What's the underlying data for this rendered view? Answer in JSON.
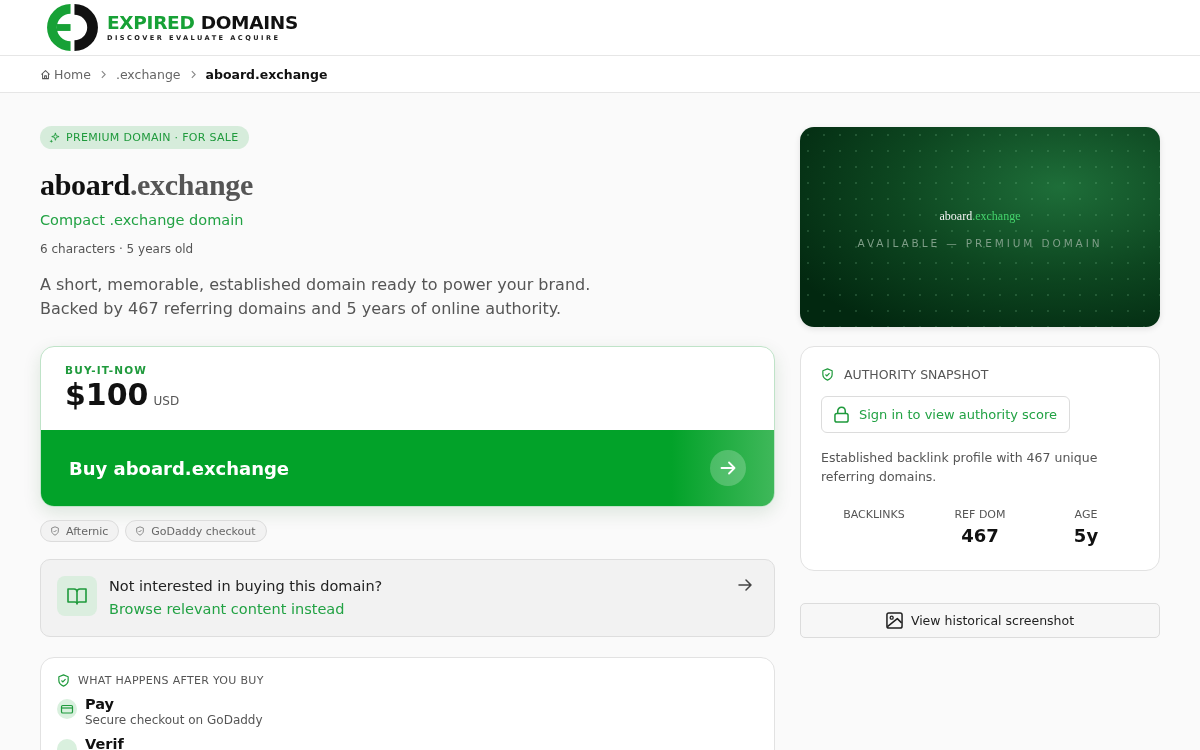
{
  "header": {
    "logo": {
      "word_1": "EXPIRED",
      "word_2": "DOMAINS",
      "tagline": "DISCOVER EVALUATE ACQUIRE"
    }
  },
  "breadcrumb": [
    {
      "label": "Home",
      "current": false
    },
    {
      "label": ".exchange",
      "current": false
    },
    {
      "label": "aboard.exchange",
      "current": true
    }
  ],
  "listing": {
    "badge": "PREMIUM DOMAIN · FOR SALE",
    "domain": {
      "name": "aboard",
      "tld": ".exchange"
    },
    "subtitle": "Compact .exchange domain",
    "meta": "6 characters · 5 years old",
    "description": "A short, memorable, established domain ready to power your brand. Backed by 467 referring domains and 5 years of online authority."
  },
  "purchase": {
    "label": "BUY-IT-NOW",
    "price": "$100",
    "currency": "USD",
    "button": "Buy aboard.exchange",
    "chips": [
      "Afternic",
      "GoDaddy checkout"
    ]
  },
  "alternative": {
    "question": "Not interested in buying this domain?",
    "link": "Browse relevant content instead"
  },
  "after_buy": {
    "title": "WHAT HAPPENS AFTER YOU BUY",
    "steps": [
      {
        "kind": "pay",
        "title": "Pay",
        "text": "Secure checkout on GoDaddy"
      },
      {
        "kind": "plain",
        "title": "Verif"
      }
    ]
  },
  "preview": {
    "name": "aboard",
    "tld": ".exchange",
    "caption": "AVAILABLE — PREMIUM DOMAIN"
  },
  "authority": {
    "title": "AUTHORITY SNAPSHOT",
    "sign_in": "Sign in to view authority score",
    "text": "Established backlink profile with 467 unique referring domains.",
    "stats": [
      {
        "label": "BACKLINKS"
      },
      {
        "label": "REF DOM",
        "value": "467"
      },
      {
        "label": "AGE",
        "value": "5y"
      }
    ]
  },
  "history_button": "View historical screenshot"
}
